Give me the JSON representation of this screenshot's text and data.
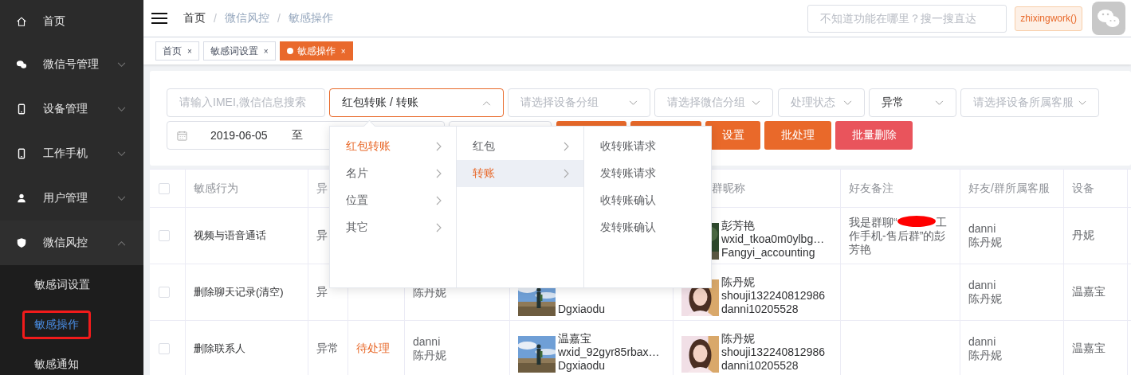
{
  "sidebar": {
    "items": [
      {
        "label": "首页",
        "kind": "link"
      },
      {
        "label": "微信号管理",
        "kind": "group",
        "expanded": false
      },
      {
        "label": "设备管理",
        "kind": "group",
        "expanded": false
      },
      {
        "label": "工作手机",
        "kind": "group",
        "expanded": false
      },
      {
        "label": "用户管理",
        "kind": "group",
        "expanded": false
      },
      {
        "label": "微信风控",
        "kind": "group",
        "expanded": true,
        "children": [
          {
            "label": "敏感词设置",
            "selected": false
          },
          {
            "label": "敏感操作",
            "selected": true
          },
          {
            "label": "敏感通知",
            "selected": false
          }
        ]
      }
    ]
  },
  "header": {
    "breadcrumb": [
      {
        "label": "首页"
      },
      {
        "sep": "/",
        "label": "微信风控"
      },
      {
        "sep": "/",
        "label": "敏感操作"
      }
    ],
    "search": {
      "placeholder": "不知道功能在哪里？搜一搜直达"
    },
    "user": "zhixingwork()"
  },
  "tabs": [
    {
      "label": "首页",
      "close": "×",
      "selected": false
    },
    {
      "label": "敏感词设置",
      "close": "×",
      "selected": false
    },
    {
      "label": "敏感操作",
      "close": "×",
      "selected": true
    }
  ],
  "filters": {
    "row_1": [
      {
        "kind": "input",
        "placeholder": "请输入IMEI,微信信息搜索"
      },
      {
        "kind": "cascader",
        "value": "红包转账 / 转账",
        "expanded": true
      },
      {
        "kind": "select",
        "placeholder": "请选择设备分组"
      },
      {
        "kind": "select",
        "placeholder": "请选择微信分组"
      },
      {
        "kind": "select",
        "placeholder": "处理状态"
      },
      {
        "kind": "select",
        "value": "异常"
      },
      {
        "kind": "select",
        "placeholder": "请选择设备所属客服"
      }
    ],
    "date_range": {
      "start": "2019-06-05",
      "to": "至"
    },
    "buttons": [
      {
        "kind": "primary"
      },
      {
        "kind": "primary"
      },
      {
        "kind": "primary",
        "label": "设置"
      },
      {
        "kind": "primary",
        "label": "批处理"
      },
      {
        "kind": "danger",
        "label": "批量删除"
      }
    ]
  },
  "cascader_menu": [
    {
      "items": [
        {
          "label": "红包转账",
          "expandable": true,
          "selected": true,
          "hovered": false
        },
        {
          "label": "名片",
          "expandable": true,
          "selected": false,
          "hovered": false
        },
        {
          "label": "位置",
          "expandable": true,
          "selected": false,
          "hovered": false
        },
        {
          "label": "其它",
          "expandable": true,
          "selected": false,
          "hovered": false
        }
      ]
    },
    {
      "items": [
        {
          "label": "红包",
          "expandable": true,
          "selected": false,
          "hovered": false
        },
        {
          "label": "转账",
          "expandable": true,
          "selected": true,
          "hovered": true
        }
      ]
    },
    {
      "items": [
        {
          "label": "收转账请求",
          "expandable": false,
          "selected": false,
          "hovered": false
        },
        {
          "label": "发转账请求",
          "expandable": false,
          "selected": false,
          "hovered": false
        },
        {
          "label": "收转账确认",
          "expandable": false,
          "selected": false,
          "hovered": false
        },
        {
          "label": "发转账确认",
          "expandable": false,
          "selected": false,
          "hovered": false
        }
      ]
    }
  ],
  "table": {
    "columns": [
      {
        "kind": "checkbox",
        "checked": false
      },
      {
        "kind": "text",
        "text": "敏感行为"
      },
      {
        "kind": "text",
        "text": "异"
      },
      {
        "kind": "blank"
      },
      {
        "kind": "blank"
      },
      {
        "kind": "blank"
      },
      {
        "kind": "text",
        "text": "群昵称"
      },
      {
        "kind": "text",
        "text": "好友备注"
      },
      {
        "kind": "text",
        "text": "好友/群所属客服"
      },
      {
        "kind": "text",
        "text": "设备"
      }
    ],
    "rows": [
      {
        "cells": [
          {
            "kind": "checkbox",
            "checked": false
          },
          {
            "kind": "title",
            "text": "视频与语音通话"
          },
          {
            "kind": "text",
            "text": "异"
          },
          {
            "kind": "blank"
          },
          {
            "kind": "blank"
          },
          {
            "kind": "blank"
          },
          {
            "kind": "profile",
            "avatar": {
              "kind": "picture"
            },
            "lines": [
              "彭芳艳",
              "wxid_tkoa0m0ylbg…",
              "Fangyi_accounting"
            ]
          },
          {
            "kind": "note",
            "before": "我是群聊“",
            "redacted": true,
            "after": "工作手机-售后群”的彭芳艳"
          },
          {
            "kind": "lines",
            "lines": [
              "danni",
              "陈丹妮"
            ]
          },
          {
            "kind": "text",
            "text": "丹妮"
          }
        ]
      },
      {
        "cells": [
          {
            "kind": "checkbox",
            "checked": false
          },
          {
            "kind": "title",
            "text": "删除聊天记录(清空)"
          },
          {
            "kind": "text",
            "text": "异"
          },
          {
            "kind": "blank"
          },
          {
            "kind": "lines",
            "lines": [
              "陈丹妮"
            ]
          },
          {
            "kind": "profile",
            "avatar": {
              "kind": "picture"
            },
            "lines": [
              "Dgxiaodu"
            ]
          },
          {
            "kind": "profile",
            "avatar": {
              "kind": "picture"
            },
            "lines": [
              "陈丹妮",
              "shouji132240812986",
              "danni10205528"
            ]
          },
          {
            "kind": "blank"
          },
          {
            "kind": "lines",
            "lines": [
              "danni",
              "陈丹妮"
            ]
          },
          {
            "kind": "text",
            "text": "温嘉宝"
          }
        ]
      },
      {
        "cells": [
          {
            "kind": "checkbox",
            "checked": false
          },
          {
            "kind": "title",
            "text": "删除联系人"
          },
          {
            "kind": "text",
            "text": "异常"
          },
          {
            "kind": "status",
            "text": "待处理"
          },
          {
            "kind": "lines",
            "lines": [
              "danni",
              "陈丹妮"
            ]
          },
          {
            "kind": "profile",
            "avatar": {
              "kind": "picture"
            },
            "lines": [
              "温嘉宝",
              "wxid_92gyr85rbax…",
              "Dgxiaodu"
            ]
          },
          {
            "kind": "profile",
            "avatar": {
              "kind": "picture"
            },
            "lines": [
              "陈丹妮",
              "shouji132240812986",
              "danni10205528"
            ]
          },
          {
            "kind": "blank"
          },
          {
            "kind": "lines",
            "lines": [
              "danni",
              "陈丹妮"
            ]
          },
          {
            "kind": "text",
            "text": "温嘉宝"
          }
        ]
      }
    ]
  }
}
